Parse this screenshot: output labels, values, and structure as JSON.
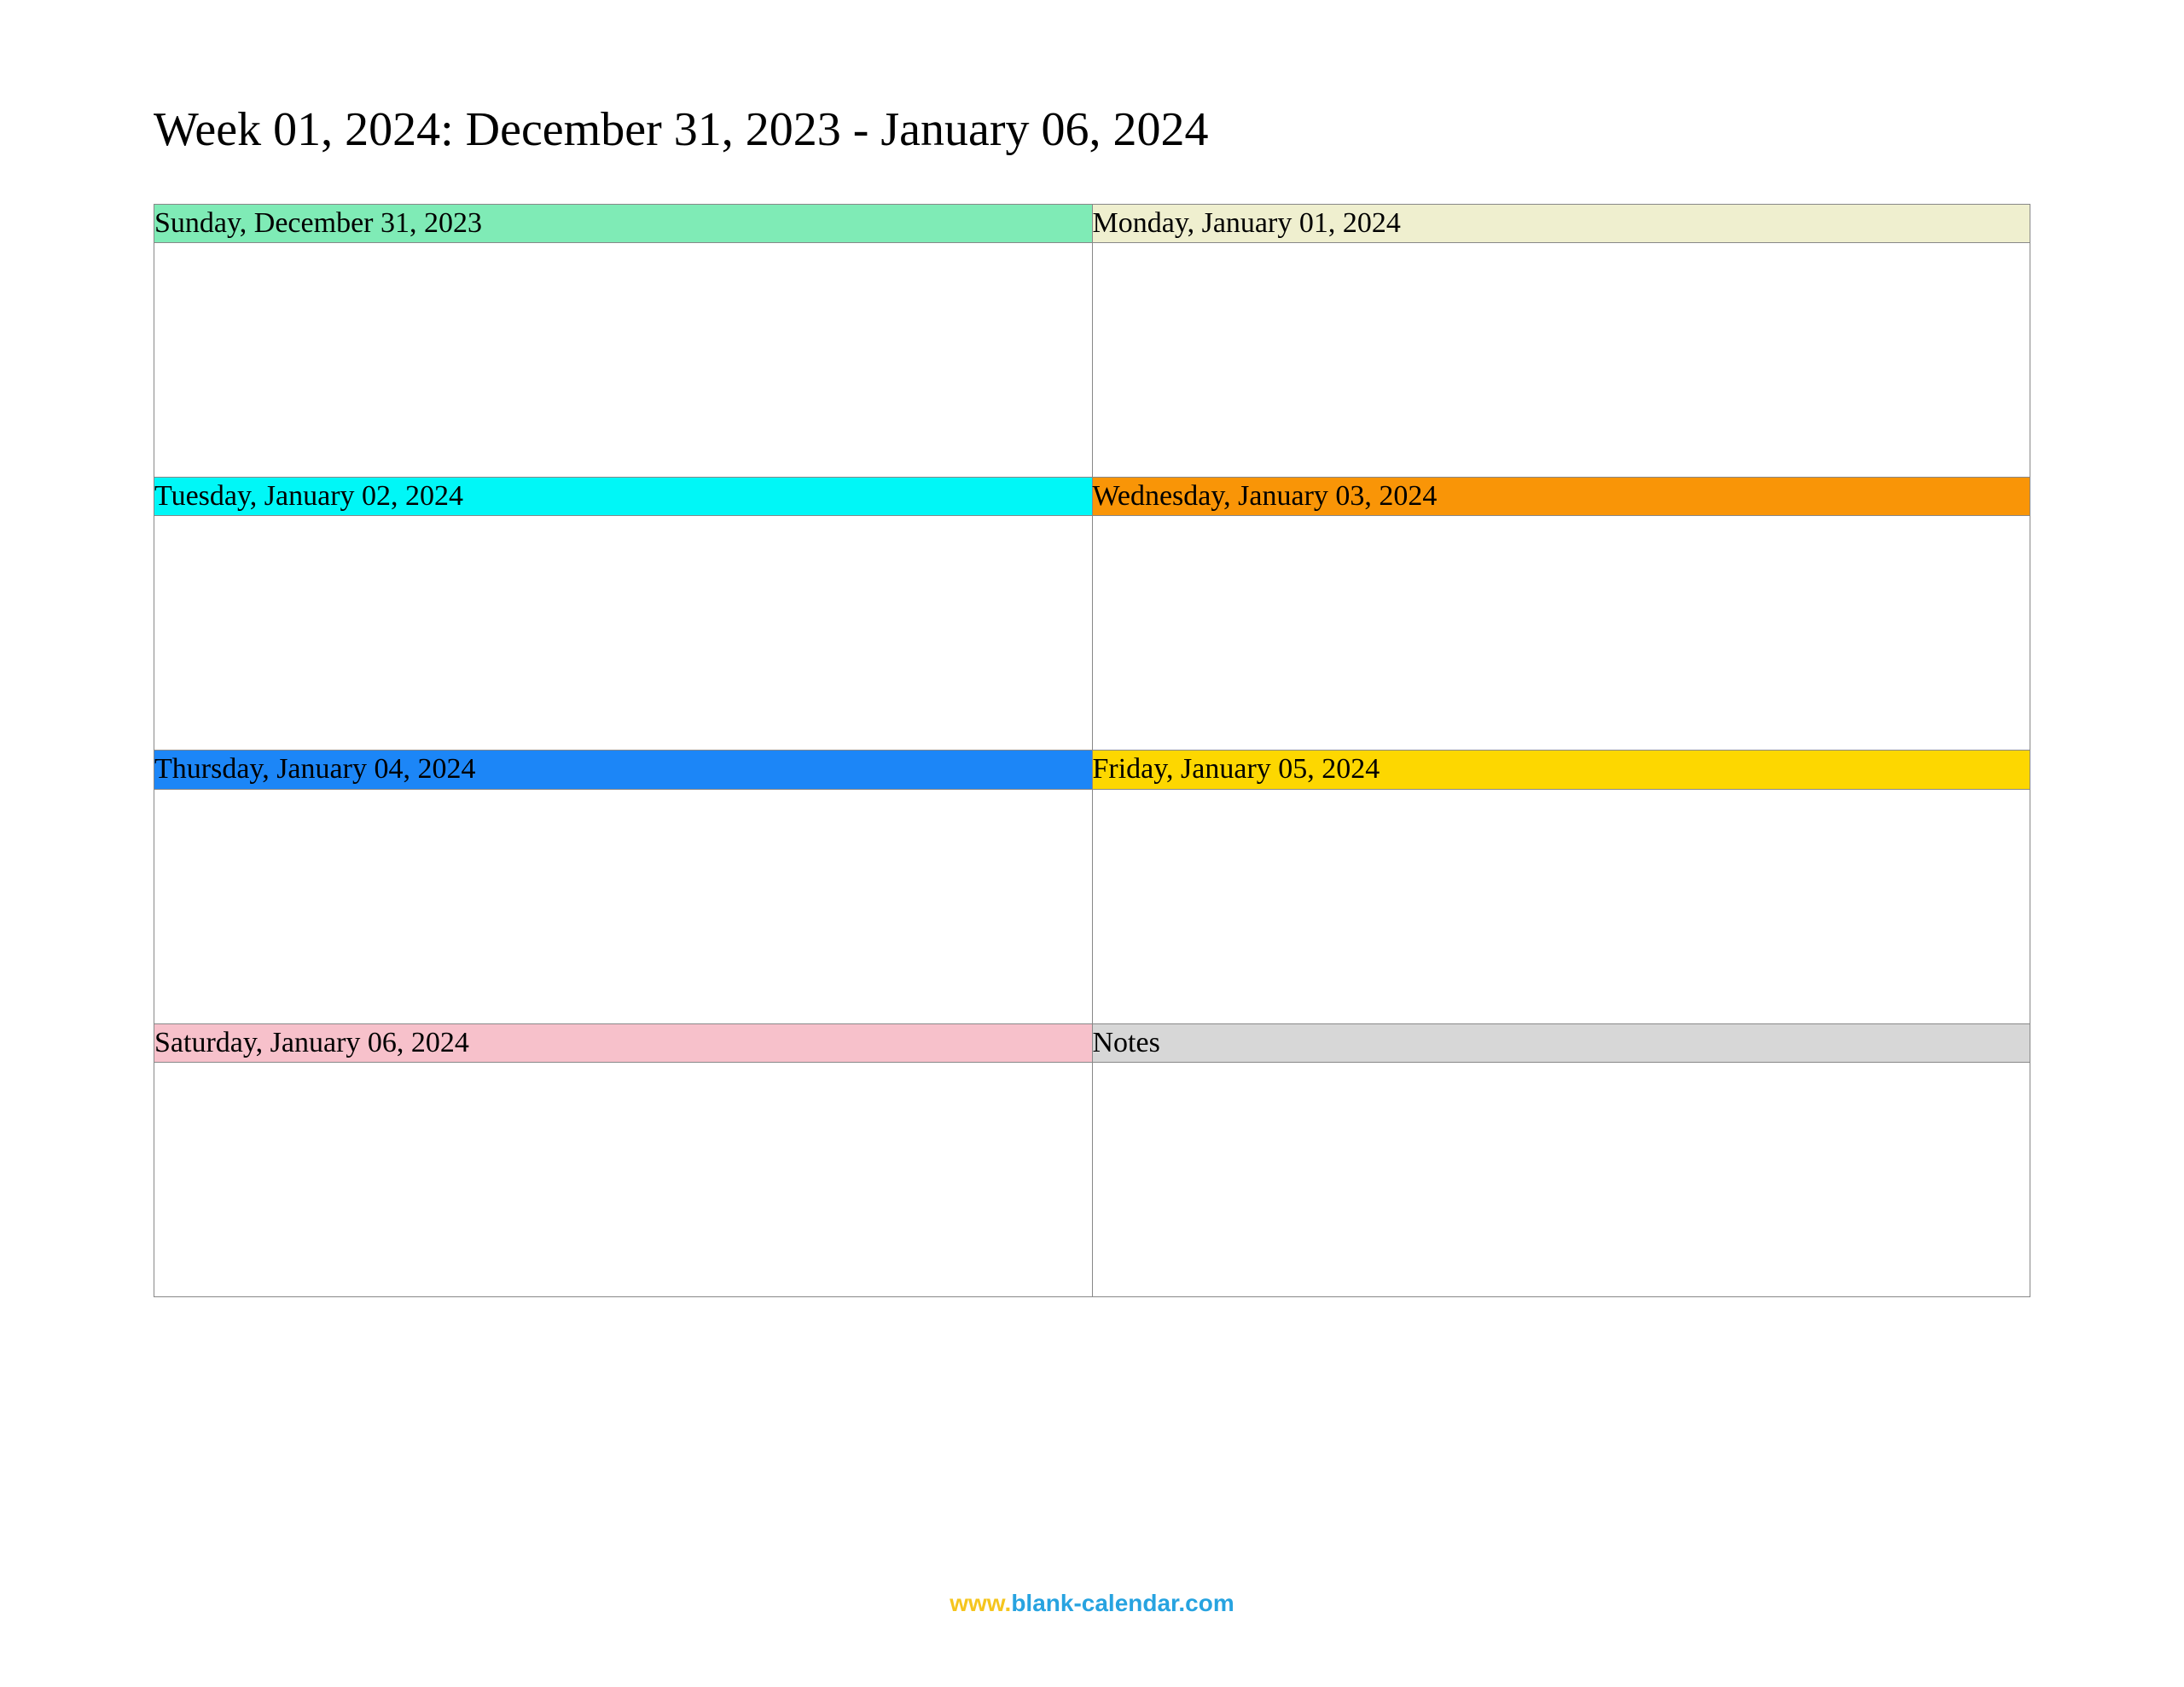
{
  "title": "Week 01, 2024: December 31, 2023 - January 06, 2024",
  "cells": {
    "sunday": {
      "label": "Sunday, December 31, 2023",
      "color": "bg-mint"
    },
    "monday": {
      "label": "Monday, January 01, 2024",
      "color": "bg-beige"
    },
    "tuesday": {
      "label": "Tuesday, January 02, 2024",
      "color": "bg-cyan"
    },
    "wednesday": {
      "label": "Wednesday, January 03, 2024",
      "color": "bg-orange"
    },
    "thursday": {
      "label": "Thursday, January 04, 2024",
      "color": "bg-blue"
    },
    "friday": {
      "label": "Friday, January 05, 2024",
      "color": "bg-yellow"
    },
    "saturday": {
      "label": "Saturday, January 06, 2024",
      "color": "bg-pink"
    },
    "notes": {
      "label": "Notes",
      "color": "bg-gray"
    }
  },
  "footer": {
    "prefix": "www.",
    "domain": "blank-calendar.com"
  }
}
